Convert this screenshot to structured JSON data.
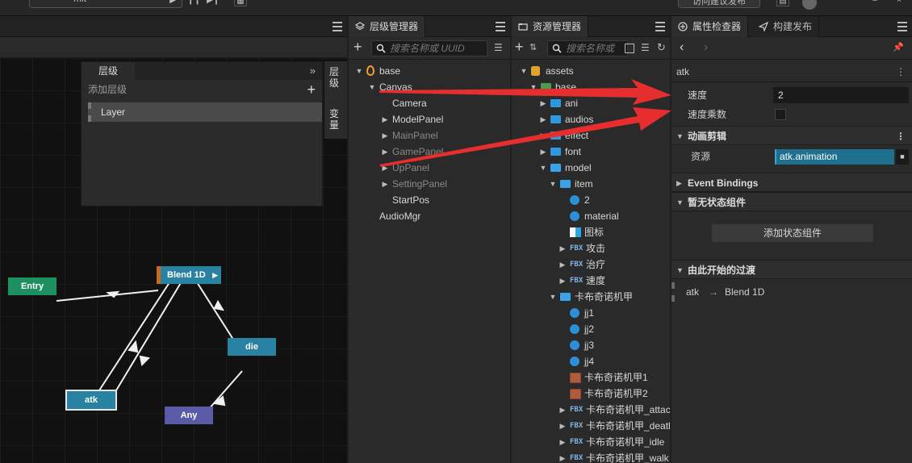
{
  "topbar": {
    "scene_name": "mit",
    "publish_label": "访问建议发布"
  },
  "animator": {
    "layers_panel": {
      "title": "层级",
      "add_layer": "添加层级",
      "layer_name": "Layer",
      "side_tab_layers": "层级",
      "side_tab_vars": "变量"
    },
    "nodes": {
      "entry": "Entry",
      "blend": "Blend 1D",
      "die": "die",
      "atk": "atk",
      "any": "Any"
    },
    "colors": {
      "entry": "#1e8f5e",
      "blend": "#2a82a2",
      "die": "#2a82a2",
      "atk": "#2a82a2",
      "any": "#5b5aa6"
    }
  },
  "hierarchy": {
    "tab_label": "层级管理器",
    "search_placeholder": "搜索名称或 UUID",
    "items": [
      {
        "label": "base",
        "depth": 0,
        "arrow": "down",
        "icon": "fire-icon"
      },
      {
        "label": "Canvas",
        "depth": 1,
        "arrow": "down"
      },
      {
        "label": "Camera",
        "depth": 2,
        "arrow": ""
      },
      {
        "label": "ModelPanel",
        "depth": 2,
        "arrow": "right"
      },
      {
        "label": "MainPanel",
        "depth": 2,
        "arrow": "right",
        "dim": true
      },
      {
        "label": "GamePanel",
        "depth": 2,
        "arrow": "right",
        "dim": true
      },
      {
        "label": "UpPanel",
        "depth": 2,
        "arrow": "right",
        "dim": true
      },
      {
        "label": "SettingPanel",
        "depth": 2,
        "arrow": "right",
        "dim": true
      },
      {
        "label": "StartPos",
        "depth": 2,
        "arrow": ""
      },
      {
        "label": "AudioMgr",
        "depth": 1,
        "arrow": ""
      }
    ]
  },
  "assets": {
    "tab_label": "资源管理器",
    "search_placeholder": "搜索名称或",
    "items": [
      {
        "label": "assets",
        "depth": 0,
        "arrow": "down",
        "type": "db"
      },
      {
        "label": "base",
        "depth": 1,
        "arrow": "down",
        "type": "folder-open-green"
      },
      {
        "label": "ani",
        "depth": 2,
        "arrow": "right",
        "type": "folder"
      },
      {
        "label": "audios",
        "depth": 2,
        "arrow": "right",
        "type": "folder"
      },
      {
        "label": "effect",
        "depth": 2,
        "arrow": "right",
        "type": "folder"
      },
      {
        "label": "font",
        "depth": 2,
        "arrow": "right",
        "type": "folder"
      },
      {
        "label": "model",
        "depth": 2,
        "arrow": "down",
        "type": "folder-open"
      },
      {
        "label": "item",
        "depth": 3,
        "arrow": "down",
        "type": "folder-open"
      },
      {
        "label": "2",
        "depth": 4,
        "arrow": "",
        "type": "ball"
      },
      {
        "label": "material",
        "depth": 4,
        "arrow": "",
        "type": "ball"
      },
      {
        "label": "图标",
        "depth": 4,
        "arrow": "",
        "type": "image"
      },
      {
        "label": "攻击",
        "depth": 4,
        "arrow": "right",
        "type": "fbx"
      },
      {
        "label": "治疗",
        "depth": 4,
        "arrow": "right",
        "type": "fbx"
      },
      {
        "label": "速度",
        "depth": 4,
        "arrow": "right",
        "type": "fbx"
      },
      {
        "label": "卡布奇诺机甲",
        "depth": 3,
        "arrow": "down",
        "type": "folder-open"
      },
      {
        "label": "jj1",
        "depth": 4,
        "arrow": "",
        "type": "ball"
      },
      {
        "label": "jj2",
        "depth": 4,
        "arrow": "",
        "type": "ball"
      },
      {
        "label": "jj3",
        "depth": 4,
        "arrow": "",
        "type": "ball"
      },
      {
        "label": "jj4",
        "depth": 4,
        "arrow": "",
        "type": "ball"
      },
      {
        "label": "卡布奇诺机甲1",
        "depth": 4,
        "arrow": "",
        "type": "texture"
      },
      {
        "label": "卡布奇诺机甲2",
        "depth": 4,
        "arrow": "",
        "type": "texture"
      },
      {
        "label": "卡布奇诺机甲_attack",
        "depth": 4,
        "arrow": "right",
        "type": "fbx"
      },
      {
        "label": "卡布奇诺机甲_death",
        "depth": 4,
        "arrow": "right",
        "type": "fbx"
      },
      {
        "label": "卡布奇诺机甲_idle",
        "depth": 4,
        "arrow": "right",
        "type": "fbx"
      },
      {
        "label": "卡布奇诺机甲_walk",
        "depth": 4,
        "arrow": "right",
        "type": "fbx"
      }
    ],
    "fbx_tag": "FBX"
  },
  "inspector": {
    "tab_label": "属性检查器",
    "tab2_label": "构建发布",
    "node_name": "atk",
    "speed_label": "速度",
    "speed_value": "2",
    "speed_mult_label": "速度乘数",
    "anim_clip_section": "动画剪辑",
    "resource_label": "资源",
    "resource_value": "atk.animation",
    "event_bindings": "Event Bindings",
    "no_state_comp": "暂无状态组件",
    "add_state_comp": "添加状态组件",
    "transitions_section": "由此开始的过渡",
    "transition_from": "atk",
    "transition_to": "Blend 1D"
  }
}
